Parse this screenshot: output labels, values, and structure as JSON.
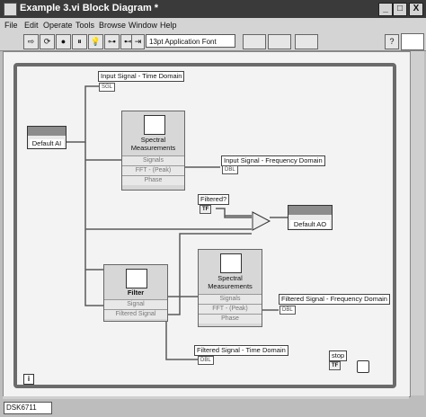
{
  "window": {
    "title": "Example 3.vi Block Diagram *",
    "buttons": [
      "_",
      "□",
      "X"
    ]
  },
  "menu": [
    "File",
    "Edit",
    "Operate",
    "Tools",
    "Browse",
    "Window",
    "Help"
  ],
  "toolbar": {
    "font": "13pt Application Font",
    "buttons": [
      "⇨",
      "⟳",
      "●",
      "⏸",
      "💡",
      "⊶",
      "⊷",
      "⇥"
    ],
    "help": "?"
  },
  "diagram": {
    "input_signal_time": "Input Signal - Time Domain",
    "input_signal_time_term": "SGL",
    "default_ai": "Default AI",
    "spectral1": {
      "name": "Spectral\nMeasurements",
      "rows": [
        "Signals",
        "FFT - (Peak)",
        "Phase"
      ]
    },
    "input_signal_freq": "Input Signal - Frequency Domain",
    "input_signal_freq_term": "DBL",
    "filtered_q": "Filtered?",
    "filtered_q_term": "TF",
    "default_ao": "Default AO",
    "filter": {
      "name": "Filter",
      "rows": [
        "Signal",
        "Filtered Signal"
      ]
    },
    "spectral2": {
      "name": "Spectral\nMeasurements",
      "rows": [
        "Signals",
        "FFT - (Peak)",
        "Phase"
      ]
    },
    "filtered_signal_freq": "Filtered Signal - Frequency Domain",
    "filtered_signal_freq_term": "DBL",
    "filtered_signal_time": "Filtered Signal - Time Domain",
    "filtered_signal_time_term": "DBL",
    "stop": "stop",
    "stop_term": "TF",
    "loop_index": "i"
  },
  "status": {
    "target": "DSK6711"
  }
}
